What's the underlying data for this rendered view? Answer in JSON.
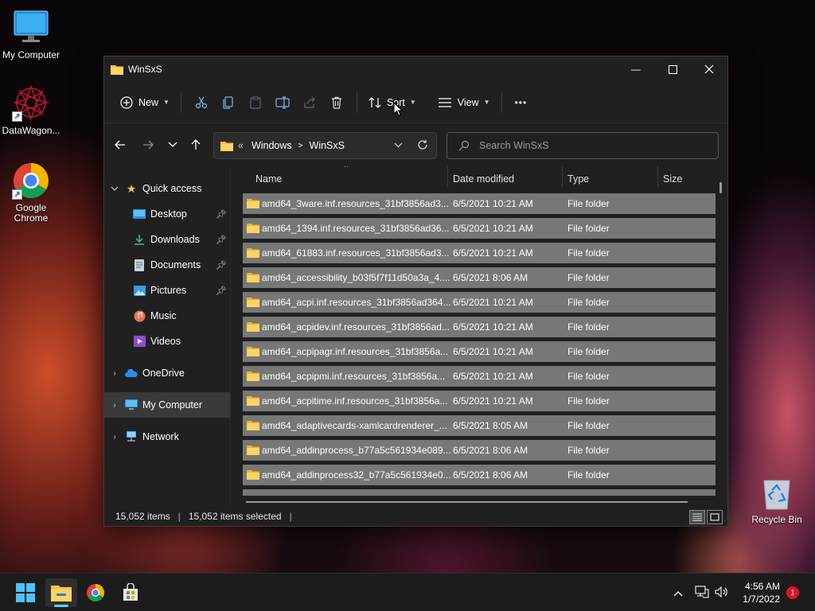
{
  "desktop": {
    "icons": [
      {
        "label": "My Computer"
      },
      {
        "label": "DataWagon..."
      },
      {
        "label": "Google\nChrome"
      }
    ],
    "recycle_bin": "Recycle Bin"
  },
  "window": {
    "title": "WinSxS",
    "controls": {
      "minimize": "—",
      "maximize": "☐",
      "close": "✕"
    }
  },
  "commandbar": {
    "new_label": "New",
    "sort_label": "Sort",
    "view_label": "View",
    "more": "•••"
  },
  "address": {
    "overflow": "«",
    "crumbs": [
      "Windows",
      "WinSxS"
    ],
    "search_placeholder": "Search WinSxS"
  },
  "sidebar": {
    "quick_access": "Quick access",
    "items": [
      {
        "label": "Desktop",
        "pinned": true
      },
      {
        "label": "Downloads",
        "pinned": true
      },
      {
        "label": "Documents",
        "pinned": true
      },
      {
        "label": "Pictures",
        "pinned": true
      },
      {
        "label": "Music",
        "pinned": false
      },
      {
        "label": "Videos",
        "pinned": false
      }
    ],
    "onedrive": "OneDrive",
    "mycomputer": "My Computer",
    "network": "Network"
  },
  "columns": {
    "name": "Name",
    "date": "Date modified",
    "type": "Type",
    "size": "Size"
  },
  "files": [
    {
      "name": "amd64_3ware.inf.resources_31bf3856ad3...",
      "date": "6/5/2021 10:21 AM",
      "type": "File folder"
    },
    {
      "name": "amd64_1394.inf.resources_31bf3856ad36...",
      "date": "6/5/2021 10:21 AM",
      "type": "File folder"
    },
    {
      "name": "amd64_61883.inf.resources_31bf3856ad3...",
      "date": "6/5/2021 10:21 AM",
      "type": "File folder"
    },
    {
      "name": "amd64_accessibility_b03f5f7f11d50a3a_4....",
      "date": "6/5/2021 8:06 AM",
      "type": "File folder"
    },
    {
      "name": "amd64_acpi.inf.resources_31bf3856ad364...",
      "date": "6/5/2021 10:21 AM",
      "type": "File folder"
    },
    {
      "name": "amd64_acpidev.inf.resources_31bf3856ad...",
      "date": "6/5/2021 10:21 AM",
      "type": "File folder"
    },
    {
      "name": "amd64_acpipagr.inf.resources_31bf3856a...",
      "date": "6/5/2021 10:21 AM",
      "type": "File folder"
    },
    {
      "name": "amd64_acpipmi.inf.resources_31bf3856a...",
      "date": "6/5/2021 10:21 AM",
      "type": "File folder"
    },
    {
      "name": "amd64_acpitime.inf.resources_31bf3856a...",
      "date": "6/5/2021 10:21 AM",
      "type": "File folder"
    },
    {
      "name": "amd64_adaptivecards-xamlcardrenderer_...",
      "date": "6/5/2021 8:05 AM",
      "type": "File folder"
    },
    {
      "name": "amd64_addinprocess_b77a5c561934e089...",
      "date": "6/5/2021 8:06 AM",
      "type": "File folder"
    },
    {
      "name": "amd64_addinprocess32_b77a5c561934e0...",
      "date": "6/5/2021 8:06 AM",
      "type": "File folder"
    }
  ],
  "status": {
    "items": "15,052 items",
    "selected": "15,052 items selected"
  },
  "taskbar": {
    "time": "4:56 AM",
    "date": "1/7/2022",
    "notifications": "1"
  },
  "colors": {
    "accent": "#60cdff",
    "folder": "#f3c34b",
    "selection": "#777777"
  }
}
